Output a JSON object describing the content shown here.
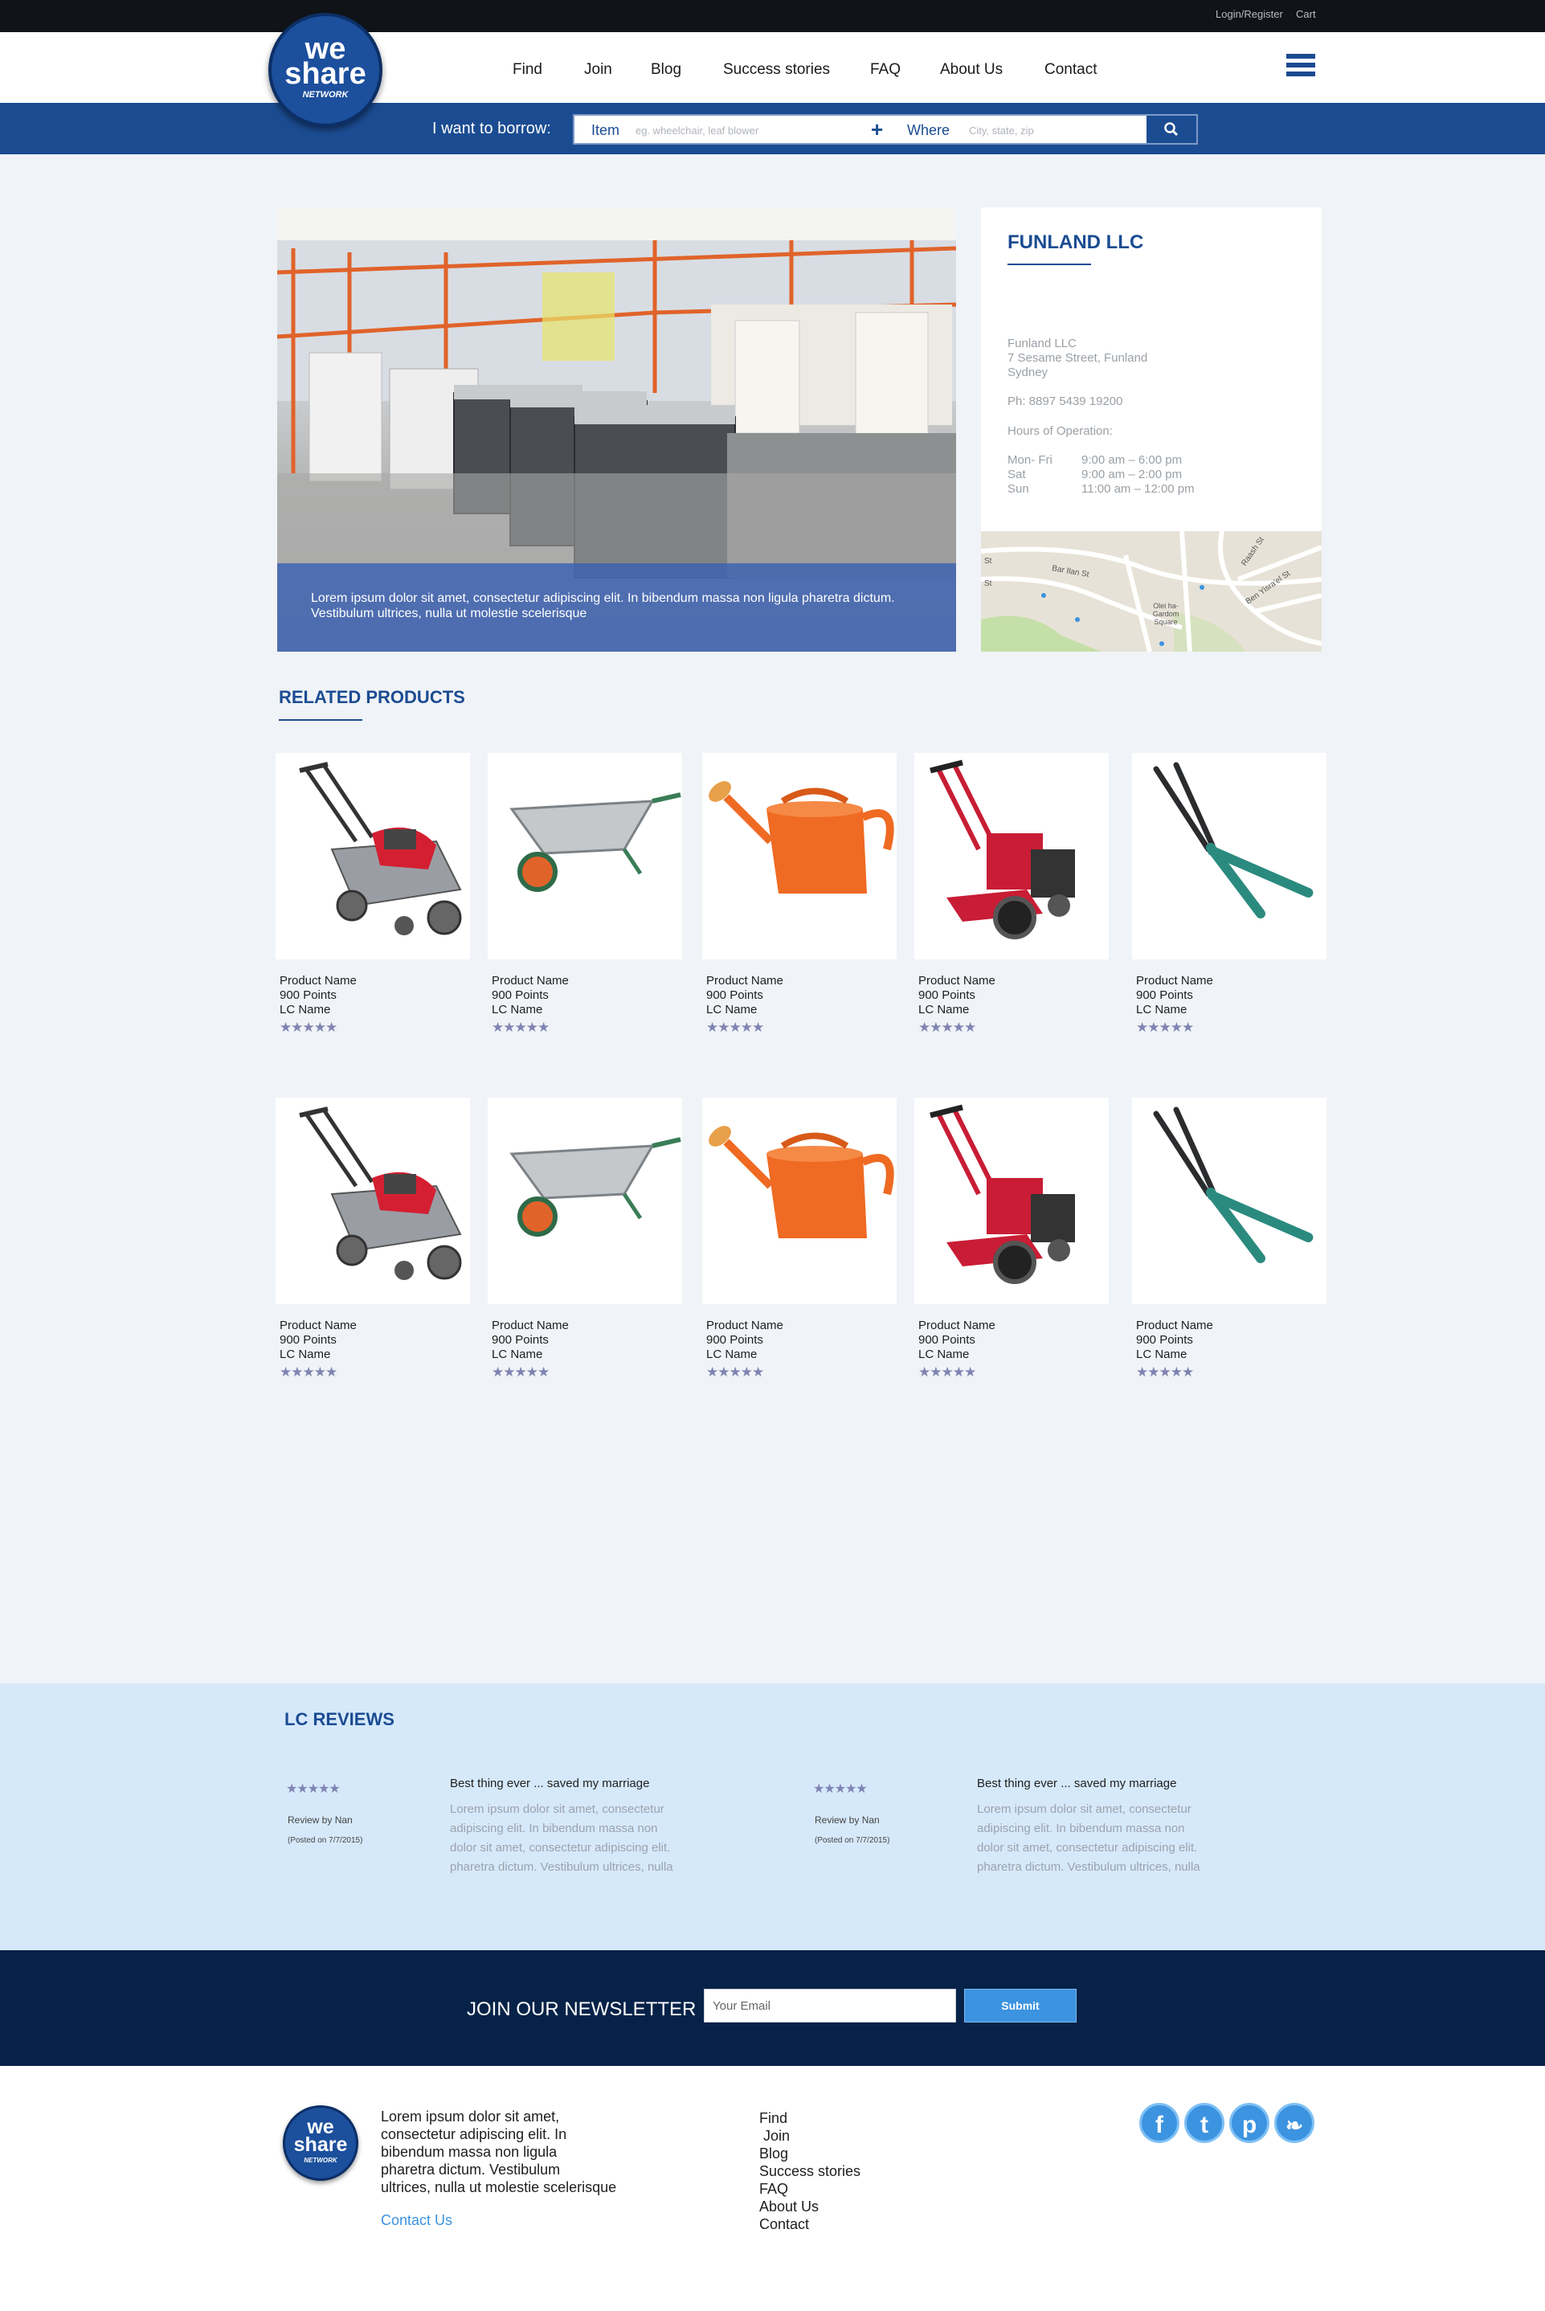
{
  "topbar": {
    "login_register": "Login/Register",
    "cart": "Cart"
  },
  "logo": {
    "line1": "we",
    "line2": "share",
    "line3": "NETWORK"
  },
  "nav": {
    "items": [
      "Find",
      "Join",
      "Blog",
      "Success stories",
      "FAQ",
      "About Us",
      "Contact"
    ],
    "menu_icon": "hamburger-icon"
  },
  "search": {
    "label": "I want to borrow:",
    "item_label": "Item",
    "item_placeholder": "eg. wheelchair, leaf blower",
    "where_label": "Where",
    "where_placeholder": "City, state, zip",
    "add_icon": "plus-icon",
    "button_icon": "search-icon"
  },
  "hero": {
    "caption": "Lorem ipsum dolor sit amet, consectetur adipiscing elit. In bibendum massa non ligula pharetra dictum. Vestibulum ultrices, nulla ut molestie scelerisque"
  },
  "store": {
    "name": "FUNLAND LLC",
    "address": [
      "Funland LLC",
      "7 Sesame Street, Funland",
      "Sydney"
    ],
    "phone": "Ph: 8897 5439 19200",
    "hours_label": "Hours of Operation:",
    "hours": [
      {
        "day": "Mon- Fri",
        "time": "9:00 am – 6:00 pm"
      },
      {
        "day": "Sat",
        "time": "9:00 am – 2:00 pm"
      },
      {
        "day": "Sun",
        "time": "11:00 am – 12:00 pm"
      }
    ],
    "map_labels": [
      "Bar Ilan St",
      "Raash St",
      "Ben Yisra'el St",
      "Olei ha-Gardom Square",
      "St",
      "St"
    ]
  },
  "related": {
    "title": "RELATED PRODUCTS",
    "rows": [
      [
        {
          "icon": "lawn-mower",
          "name": "Product Name",
          "points": "900 Points",
          "lc": "LC Name",
          "stars": "★★★★★"
        },
        {
          "icon": "wheelbarrow",
          "name": "Product Name",
          "points": "900 Points",
          "lc": "LC Name",
          "stars": "★★★★★"
        },
        {
          "icon": "watering-can",
          "name": "Product Name",
          "points": "900 Points",
          "lc": "LC Name",
          "stars": "★★★★★"
        },
        {
          "icon": "tiller",
          "name": "Product Name",
          "points": "900 Points",
          "lc": "LC Name",
          "stars": "★★★★★"
        },
        {
          "icon": "hedge-shears",
          "name": "Product Name",
          "points": "900 Points",
          "lc": "LC Name",
          "stars": "★★★★★"
        }
      ],
      [
        {
          "icon": "lawn-mower",
          "name": "Product Name",
          "points": "900 Points",
          "lc": "LC Name",
          "stars": "★★★★★"
        },
        {
          "icon": "wheelbarrow",
          "name": "Product Name",
          "points": "900 Points",
          "lc": "LC Name",
          "stars": "★★★★★"
        },
        {
          "icon": "watering-can",
          "name": "Product Name",
          "points": "900 Points",
          "lc": "LC Name",
          "stars": "★★★★★"
        },
        {
          "icon": "tiller",
          "name": "Product Name",
          "points": "900 Points",
          "lc": "LC Name",
          "stars": "★★★★★"
        },
        {
          "icon": "hedge-shears",
          "name": "Product Name",
          "points": "900 Points",
          "lc": "LC Name",
          "stars": "★★★★★"
        }
      ]
    ]
  },
  "reviews": {
    "title": "LC REVIEWS",
    "items": [
      {
        "stars": "★★★★★",
        "by": "Review by Nan",
        "posted": "(Posted on 7/7/2015)",
        "headline": "Best thing ever ... saved my marriage",
        "lines": [
          "Lorem ipsum dolor sit amet, consectetur",
          "adipiscing elit. In bibendum massa non",
          "dolor sit amet, consectetur adipiscing elit.",
          "pharetra dictum. Vestibulum ultrices, nulla"
        ]
      },
      {
        "stars": "★★★★★",
        "by": "Review by Nan",
        "posted": "(Posted on 7/7/2015)",
        "headline": "Best thing ever ... saved my marriage",
        "lines": [
          "Lorem ipsum dolor sit amet, consectetur",
          "adipiscing elit. In bibendum massa non",
          "dolor sit amet, consectetur adipiscing elit.",
          "pharetra dictum. Vestibulum ultrices, nulla"
        ]
      }
    ]
  },
  "newsletter": {
    "title": "JOIN OUR NEWSLETTER",
    "placeholder": "Your Email",
    "submit": "Submit"
  },
  "footer": {
    "text_lines": [
      "Lorem ipsum dolor sit amet,",
      "consectetur adipiscing elit. In",
      "bibendum massa non ligula",
      "pharetra dictum. Vestibulum",
      "ultrices, nulla ut molestie scelerisque"
    ],
    "contact": "Contact Us",
    "links": [
      "Find",
      " Join",
      "Blog",
      "Success stories",
      "FAQ",
      "About Us",
      "Contact"
    ],
    "social": [
      {
        "icon": "facebook-icon",
        "glyph": "f"
      },
      {
        "icon": "tumblr-icon",
        "glyph": "t"
      },
      {
        "icon": "pinterest-icon",
        "glyph": "p"
      },
      {
        "icon": "twitter-icon",
        "glyph": "❧"
      }
    ]
  },
  "colors": {
    "brand_blue": "#1b4c92",
    "navy": "#072248",
    "accent": "#3c93e0",
    "reviews_bg": "#d6e9fb"
  }
}
